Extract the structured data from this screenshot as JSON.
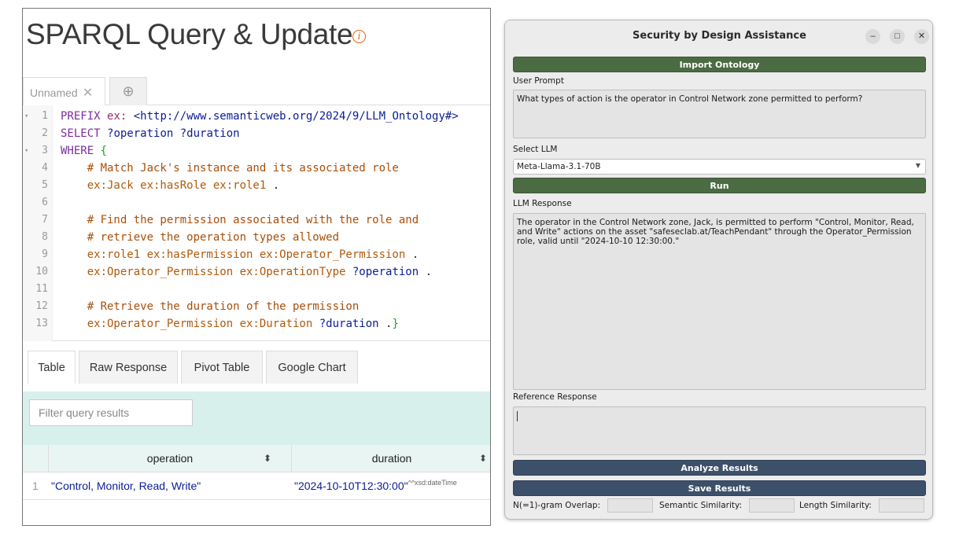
{
  "left": {
    "title": "SPARQL Query & Update",
    "info_icon": "info-icon",
    "editor_tab": "Unnamed",
    "editor_tab_close": "✕",
    "add_tab": "⊕",
    "result_tabs": [
      "Table",
      "Raw Response",
      "Pivot Table",
      "Google Chart"
    ],
    "filter_placeholder": "Filter query results",
    "table": {
      "headers": [
        "operation",
        "duration"
      ],
      "row_num": "1",
      "operation": "\"Control, Monitor, Read, Write\"",
      "duration": "\"2024-10-10T12:30:00\"",
      "duration_type": "^^xsd:dateTime"
    },
    "code": [
      {
        "n": "1",
        "fold": "▾",
        "parts": [
          [
            "kw",
            "PREFIX "
          ],
          [
            "pref",
            "ex: "
          ],
          [
            "iri",
            "<http://www.semanticweb.org/2024/9/LLM_Ontology#>"
          ]
        ]
      },
      {
        "n": "2",
        "fold": "",
        "parts": [
          [
            "kw",
            "SELECT "
          ],
          [
            "var",
            "?operation ?duration"
          ]
        ]
      },
      {
        "n": "3",
        "fold": "▾",
        "parts": [
          [
            "kw",
            "WHERE "
          ],
          [
            "brace",
            "{"
          ]
        ]
      },
      {
        "n": "4",
        "fold": "",
        "parts": [
          [
            "cmt",
            "    # Match Jack's instance and its associated role"
          ]
        ]
      },
      {
        "n": "5",
        "fold": "",
        "parts": [
          [
            "uri",
            "    ex:Jack ex:hasRole ex:role1"
          ],
          [
            "punct",
            " ."
          ]
        ]
      },
      {
        "n": "6",
        "fold": "",
        "parts": []
      },
      {
        "n": "7",
        "fold": "",
        "parts": [
          [
            "cmt",
            "    # Find the permission associated with the role and"
          ]
        ]
      },
      {
        "n": "8",
        "fold": "",
        "parts": [
          [
            "cmt",
            "    # retrieve the operation types allowed"
          ]
        ]
      },
      {
        "n": "9",
        "fold": "",
        "parts": [
          [
            "uri",
            "    ex:role1 ex:hasPermission ex:Operator_Permission"
          ],
          [
            "punct",
            " ."
          ]
        ]
      },
      {
        "n": "10",
        "fold": "",
        "parts": [
          [
            "uri",
            "    ex:Operator_Permission ex:OperationType "
          ],
          [
            "var",
            "?operation"
          ],
          [
            "punct",
            " ."
          ]
        ]
      },
      {
        "n": "11",
        "fold": "",
        "parts": []
      },
      {
        "n": "12",
        "fold": "",
        "parts": [
          [
            "cmt",
            "    # Retrieve the duration of the permission"
          ]
        ]
      },
      {
        "n": "13",
        "fold": "",
        "parts": [
          [
            "uri",
            "    ex:Operator_Permission ex:Duration "
          ],
          [
            "var",
            "?duration"
          ],
          [
            "punct",
            " ."
          ],
          [
            "brace",
            "}"
          ]
        ]
      }
    ]
  },
  "dialog": {
    "title": "Security by Design Assistance",
    "window_buttons": [
      "–",
      "□",
      "✕"
    ],
    "import_button": "Import Ontology",
    "user_prompt_label": "User Prompt",
    "user_prompt": "What types of action is the operator in Control Network zone permitted to perform?",
    "select_llm_label": "Select LLM",
    "selected_llm": "Meta-Llama-3.1-70B",
    "run_button": "Run",
    "llm_response_label": "LLM Response",
    "llm_response": "The operator in the Control Network zone, Jack, is permitted to perform \"Control, Monitor, Read, and Write\" actions on the asset \"safeseclab.at/TeachPendant\" through the Operator_Permission role, valid until \"2024-10-10 12:30:00.\"",
    "reference_label": "Reference Response",
    "analyze_button": "Analyze Results",
    "save_button": "Save Results",
    "metrics": [
      "N(=1)-gram Overlap:",
      "Semantic Similarity:",
      "Length Similarity:"
    ]
  },
  "colors": {
    "green_button": "#4b6b43",
    "navy_button": "#3d506a",
    "results_bg": "#d8f0ec",
    "info_orange": "#e0661c"
  }
}
